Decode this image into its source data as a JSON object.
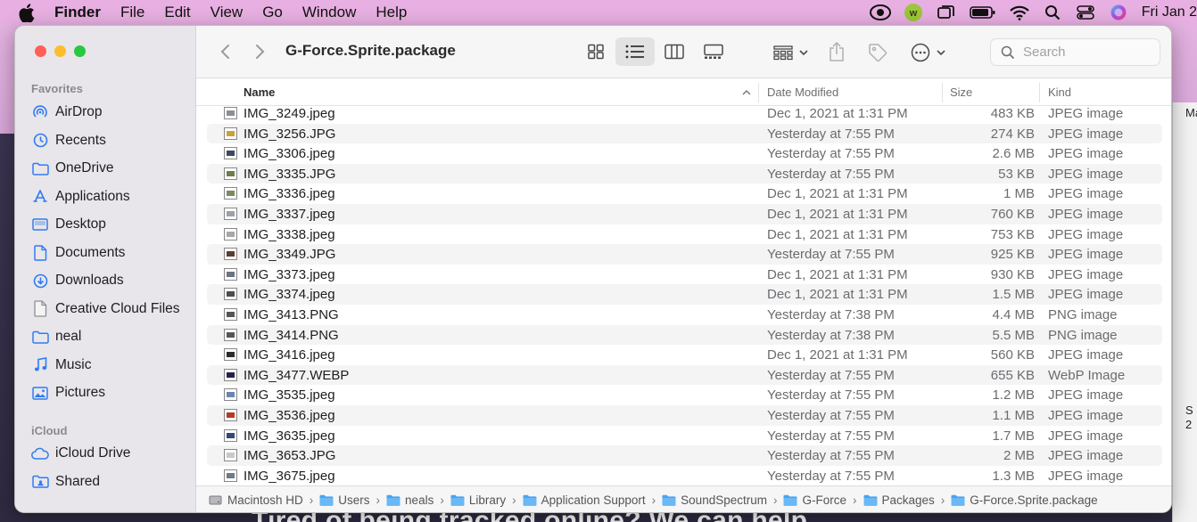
{
  "menubar": {
    "app_name": "Finder",
    "items": [
      "File",
      "Edit",
      "View",
      "Go",
      "Window",
      "Help"
    ],
    "clock": "Fri Jan 2"
  },
  "background": {
    "banner_text": "Tired of being tracked online? We can help."
  },
  "window": {
    "title": "G-Force.Sprite.package",
    "search_placeholder": "Search"
  },
  "sidebar": {
    "favorites_heading": "Favorites",
    "favorites": [
      {
        "label": "AirDrop",
        "icon": "airdrop-icon"
      },
      {
        "label": "Recents",
        "icon": "clock-icon"
      },
      {
        "label": "OneDrive",
        "icon": "folder-icon"
      },
      {
        "label": "Applications",
        "icon": "applications-icon"
      },
      {
        "label": "Desktop",
        "icon": "desktop-icon"
      },
      {
        "label": "Documents",
        "icon": "document-icon"
      },
      {
        "label": "Downloads",
        "icon": "download-icon"
      },
      {
        "label": "Creative Cloud Files",
        "icon": "file-icon"
      },
      {
        "label": "neal",
        "icon": "folder-icon"
      },
      {
        "label": "Music",
        "icon": "music-icon"
      },
      {
        "label": "Pictures",
        "icon": "pictures-icon"
      }
    ],
    "icloud_heading": "iCloud",
    "icloud": [
      {
        "label": "iCloud Drive",
        "icon": "cloud-icon"
      },
      {
        "label": "Shared",
        "icon": "shared-folder-icon"
      }
    ]
  },
  "columns": {
    "name": "Name",
    "date": "Date Modified",
    "size": "Size",
    "kind": "Kind"
  },
  "files": [
    {
      "name": "IMG_3249.jpeg",
      "date": "Dec 1, 2021 at 1:31 PM",
      "size": "483 KB",
      "kind": "JPEG image",
      "thumb": "#8a8f96"
    },
    {
      "name": "IMG_3256.JPG",
      "date": "Yesterday at 7:55 PM",
      "size": "274 KB",
      "kind": "JPEG image",
      "thumb": "#c9a23a"
    },
    {
      "name": "IMG_3306.jpeg",
      "date": "Yesterday at 7:55 PM",
      "size": "2.6 MB",
      "kind": "JPEG image",
      "thumb": "#3b4a60"
    },
    {
      "name": "IMG_3335.JPG",
      "date": "Yesterday at 7:55 PM",
      "size": "53 KB",
      "kind": "JPEG image",
      "thumb": "#6d7d4e"
    },
    {
      "name": "IMG_3336.jpeg",
      "date": "Dec 1, 2021 at 1:31 PM",
      "size": "1 MB",
      "kind": "JPEG image",
      "thumb": "#7c8a5f"
    },
    {
      "name": "IMG_3337.jpeg",
      "date": "Dec 1, 2021 at 1:31 PM",
      "size": "760 KB",
      "kind": "JPEG image",
      "thumb": "#9aa1a8"
    },
    {
      "name": "IMG_3338.jpeg",
      "date": "Dec 1, 2021 at 1:31 PM",
      "size": "753 KB",
      "kind": "JPEG image",
      "thumb": "#a7a7a7"
    },
    {
      "name": "IMG_3349.JPG",
      "date": "Yesterday at 7:55 PM",
      "size": "925 KB",
      "kind": "JPEG image",
      "thumb": "#5a3e2a"
    },
    {
      "name": "IMG_3373.jpeg",
      "date": "Dec 1, 2021 at 1:31 PM",
      "size": "930 KB",
      "kind": "JPEG image",
      "thumb": "#6b7380"
    },
    {
      "name": "IMG_3374.jpeg",
      "date": "Dec 1, 2021 at 1:31 PM",
      "size": "1.5 MB",
      "kind": "JPEG image",
      "thumb": "#4d4d4d"
    },
    {
      "name": "IMG_3413.PNG",
      "date": "Yesterday at 7:38 PM",
      "size": "4.4 MB",
      "kind": "PNG image",
      "thumb": "#555555"
    },
    {
      "name": "IMG_3414.PNG",
      "date": "Yesterday at 7:38 PM",
      "size": "5.5 MB",
      "kind": "PNG image",
      "thumb": "#555555"
    },
    {
      "name": "IMG_3416.jpeg",
      "date": "Dec 1, 2021 at 1:31 PM",
      "size": "560 KB",
      "kind": "JPEG image",
      "thumb": "#2c2c2c"
    },
    {
      "name": "IMG_3477.WEBP",
      "date": "Yesterday at 7:55 PM",
      "size": "655 KB",
      "kind": "WebP Image",
      "thumb": "#2a1f4a"
    },
    {
      "name": "IMG_3535.jpeg",
      "date": "Yesterday at 7:55 PM",
      "size": "1.2 MB",
      "kind": "JPEG image",
      "thumb": "#6a86b0"
    },
    {
      "name": "IMG_3536.jpeg",
      "date": "Yesterday at 7:55 PM",
      "size": "1.1 MB",
      "kind": "JPEG image",
      "thumb": "#b23a2a"
    },
    {
      "name": "IMG_3635.jpeg",
      "date": "Yesterday at 7:55 PM",
      "size": "1.7 MB",
      "kind": "JPEG image",
      "thumb": "#2f4a7a"
    },
    {
      "name": "IMG_3653.JPG",
      "date": "Yesterday at 7:55 PM",
      "size": "2 MB",
      "kind": "JPEG image",
      "thumb": "#c8c8c8"
    },
    {
      "name": "IMG_3675.jpeg",
      "date": "Yesterday at 7:55 PM",
      "size": "1.3 MB",
      "kind": "JPEG image",
      "thumb": "#707a86"
    }
  ],
  "path": [
    {
      "label": "Macintosh HD",
      "icon": "disk-icon"
    },
    {
      "label": "Users",
      "icon": "folder-icon"
    },
    {
      "label": "neals",
      "icon": "home-folder-icon"
    },
    {
      "label": "Library",
      "icon": "folder-icon"
    },
    {
      "label": "Application Support",
      "icon": "folder-icon"
    },
    {
      "label": "SoundSpectrum",
      "icon": "folder-icon"
    },
    {
      "label": "G-Force",
      "icon": "folder-icon"
    },
    {
      "label": "Packages",
      "icon": "folder-icon"
    },
    {
      "label": "G-Force.Sprite.package",
      "icon": "package-icon"
    }
  ],
  "right_edge_text": [
    "Ma",
    "S",
    "2"
  ],
  "colors": {
    "accent": "#2f7bf5",
    "folder": "#4aa3ef",
    "sidebar_bg": "#e8e6ea"
  }
}
